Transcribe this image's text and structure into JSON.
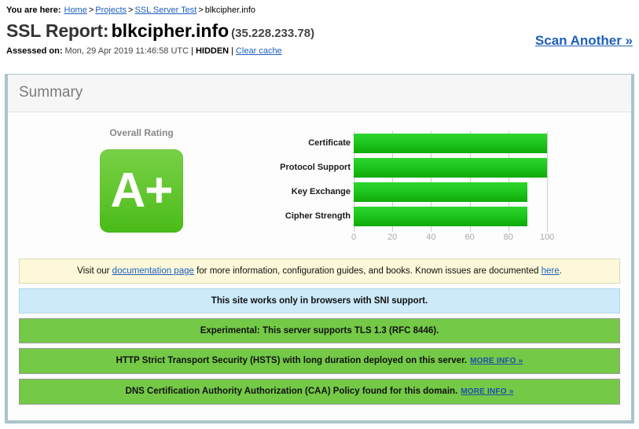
{
  "breadcrumb": {
    "label": "You are here:",
    "items": [
      {
        "text": "Home",
        "link": true
      },
      {
        "text": "Projects",
        "link": true
      },
      {
        "text": "SSL Server Test",
        "link": true
      },
      {
        "text": "blkcipher.info",
        "link": false
      }
    ],
    "separator": ">"
  },
  "header": {
    "title_prefix": "SSL Report:",
    "hostname": "blkcipher.info",
    "ip": "(35.228.233.78)",
    "assessed_label": "Assessed on:",
    "assessed_date": "Mon, 29 Apr 2019 11:46:58 UTC",
    "hidden_label": "HIDDEN",
    "clear_cache_label": "Clear cache",
    "separator": "|",
    "scan_another_label": "Scan Another »"
  },
  "summary": {
    "panel_title": "Summary",
    "rating_caption": "Overall Rating",
    "grade": "A+",
    "grade_color": "#5ec62c"
  },
  "chart_data": {
    "type": "bar",
    "orientation": "horizontal",
    "title": "",
    "xlabel": "",
    "ylabel": "",
    "categories": [
      "Certificate",
      "Protocol Support",
      "Key Exchange",
      "Cipher Strength"
    ],
    "values": [
      100,
      100,
      90,
      90
    ],
    "xlim": [
      0,
      100
    ],
    "xticks": [
      0,
      20,
      40,
      60,
      80,
      100
    ],
    "xtick_labels": [
      "0",
      "20",
      "40",
      "60",
      "80",
      "100"
    ],
    "grid": true,
    "legend": false,
    "bar_color": "#1fc61f"
  },
  "notices": [
    {
      "style": "warn",
      "parts": [
        {
          "text": "Visit our ",
          "link": false
        },
        {
          "text": "documentation page",
          "link": true
        },
        {
          "text": " for more information, configuration guides, and books. Known issues are documented ",
          "link": false
        },
        {
          "text": "here",
          "link": true
        },
        {
          "text": ".",
          "link": false
        }
      ]
    },
    {
      "style": "info",
      "parts": [
        {
          "text": "This site works only in browsers with SNI support.",
          "link": false
        }
      ]
    },
    {
      "style": "good",
      "parts": [
        {
          "text": "Experimental: This server supports TLS 1.3 (RFC 8446).",
          "link": false
        }
      ]
    },
    {
      "style": "good",
      "parts": [
        {
          "text": "HTTP Strict Transport Security (HSTS) with long duration deployed on this server.",
          "link": false
        },
        {
          "text": "MORE INFO »",
          "link": true,
          "more": true
        }
      ]
    },
    {
      "style": "good",
      "parts": [
        {
          "text": "DNS Certification Authority Authorization (CAA) Policy found for this domain.",
          "link": false
        },
        {
          "text": "MORE INFO »",
          "link": true,
          "more": true
        }
      ]
    }
  ]
}
